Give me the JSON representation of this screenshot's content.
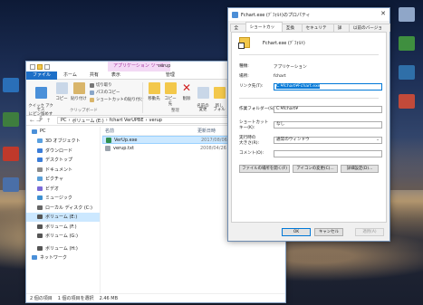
{
  "explorer": {
    "tool_tab": "アプリケーション ツール",
    "tool_title": "verup",
    "tabs": [
      "ファイル",
      "ホーム",
      "共有",
      "表示",
      "管理"
    ],
    "ribbon": {
      "quick_access": "クイック アクセス\nにピン留めする",
      "copy": "コピー",
      "paste": "貼り付け",
      "cut": "切り取り",
      "copy_path": "パスのコピー",
      "paste_shortcut": "ショートカットの貼り付け",
      "clipboard_group": "クリップボード",
      "move_to": "移動先",
      "copy_to": "コピー先",
      "delete": "削除",
      "rename": "名前の\n変更",
      "new": "新し\nフォル",
      "organize_group": "整理"
    },
    "address": {
      "back": "←",
      "forward": "→",
      "up": "↑",
      "path": [
        "PC",
        "›",
        "ボリューム (E:)",
        "›",
        "fchart VerUPBE",
        "›",
        "verup"
      ]
    },
    "nav_items": [
      {
        "label": "PC",
        "color": "#4a90d9"
      },
      {
        "label": "3D オブジェクト",
        "color": "#5aa0e0"
      },
      {
        "label": "ダウンロード",
        "color": "#3b7dd8"
      },
      {
        "label": "デスクトップ",
        "color": "#3b7dd8"
      },
      {
        "label": "ドキュメント",
        "color": "#8a8a8a"
      },
      {
        "label": "ピクチャ",
        "color": "#5a9fd8"
      },
      {
        "label": "ビデオ",
        "color": "#7a6ad8"
      },
      {
        "label": "ミュージック",
        "color": "#3d8fd0"
      },
      {
        "label": "ローカル ディスク (C:)",
        "color": "#666"
      },
      {
        "label": "ボリューム (E:)",
        "color": "#555"
      },
      {
        "label": "ボリューム (F:)",
        "color": "#555"
      },
      {
        "label": "ボリューム (G:)",
        "color": "#555"
      },
      {
        "label": "ボリューム (H:)",
        "color": "#555"
      },
      {
        "label": "ネットワーク",
        "color": "#4a90d9"
      }
    ],
    "selected_nav": "ボリューム (E:)",
    "columns": {
      "name": "名前",
      "date": "更新日時"
    },
    "files": [
      {
        "name": "VerUp.exe",
        "date": "2017/08/06",
        "selected": true,
        "color": "#2f8f4f"
      },
      {
        "name": "verup.txt",
        "date": "2008/04/26",
        "selected": false,
        "color": "#9aa3ad"
      }
    ],
    "status": {
      "items": "2 個の項目",
      "selection": "1 個の項目を選択",
      "size": "2.46 MB"
    }
  },
  "dialog": {
    "title": "Fchart.exe (ﾃﾞﾌｫﾙﾄ)のプロパティ",
    "close": "✕",
    "tabs": [
      "全般",
      "ショートカット",
      "互換性",
      "セキュリティ",
      "詳細",
      "以前のバージョン"
    ],
    "active_tab": "ショートカット",
    "app_name": "Fchart.exe (ﾃﾞﾌｫﾙﾄ)",
    "fields": {
      "type_label": "種類:",
      "type_value": "アプリケーション",
      "location_label": "場所:",
      "location_value": "fchart",
      "target_label": "リンク先(T):",
      "target_value": "C:¥fchart¥Fchart.exe",
      "workdir_label": "作業フォルダー(S):",
      "workdir_value": "C:¥fchart¥",
      "shortcut_label": "ショートカット\nキー(K):",
      "shortcut_value": "なし",
      "run_label": "実行時の\n大きさ(R):",
      "run_value": "通常のウィンドウ",
      "comment_label": "コメント(O):",
      "comment_value": ""
    },
    "buttons": {
      "open_location": "ファイルの場所を開く(F)",
      "change_icon": "アイコンの変更(C)...",
      "advanced": "詳細設定(D)...",
      "ok": "OK",
      "cancel": "キャンセル",
      "apply": "適用(A)"
    }
  }
}
